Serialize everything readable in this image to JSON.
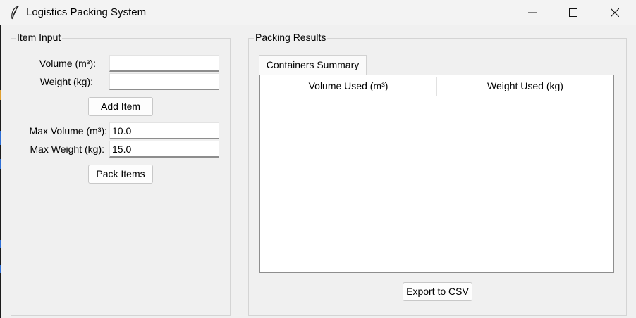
{
  "window": {
    "title": "Logistics Packing System",
    "icon": "feather-icon",
    "controls": [
      "minimize-icon",
      "maximize-icon",
      "close-icon"
    ]
  },
  "item_input": {
    "group_label": "Item Input",
    "volume_label": "Volume (m³):",
    "volume_value": "",
    "weight_label": "Weight (kg):",
    "weight_value": "",
    "add_button": "Add Item",
    "max_volume_label": "Max Volume (m³):",
    "max_volume_value": "10.0",
    "max_weight_label": "Max Weight (kg):",
    "max_weight_value": "15.0",
    "pack_button": "Pack Items"
  },
  "packing_results": {
    "group_label": "Packing Results",
    "tab_label": "Containers Summary",
    "columns": [
      "Volume Used (m³)",
      "Weight Used (kg)"
    ],
    "rows": [],
    "export_button": "Export to CSV"
  },
  "colors": {
    "background": "#f0f0f0",
    "titlebar": "#f3f3f3",
    "entry_background": "#ffffff",
    "group_border": "#d4d4d4"
  }
}
